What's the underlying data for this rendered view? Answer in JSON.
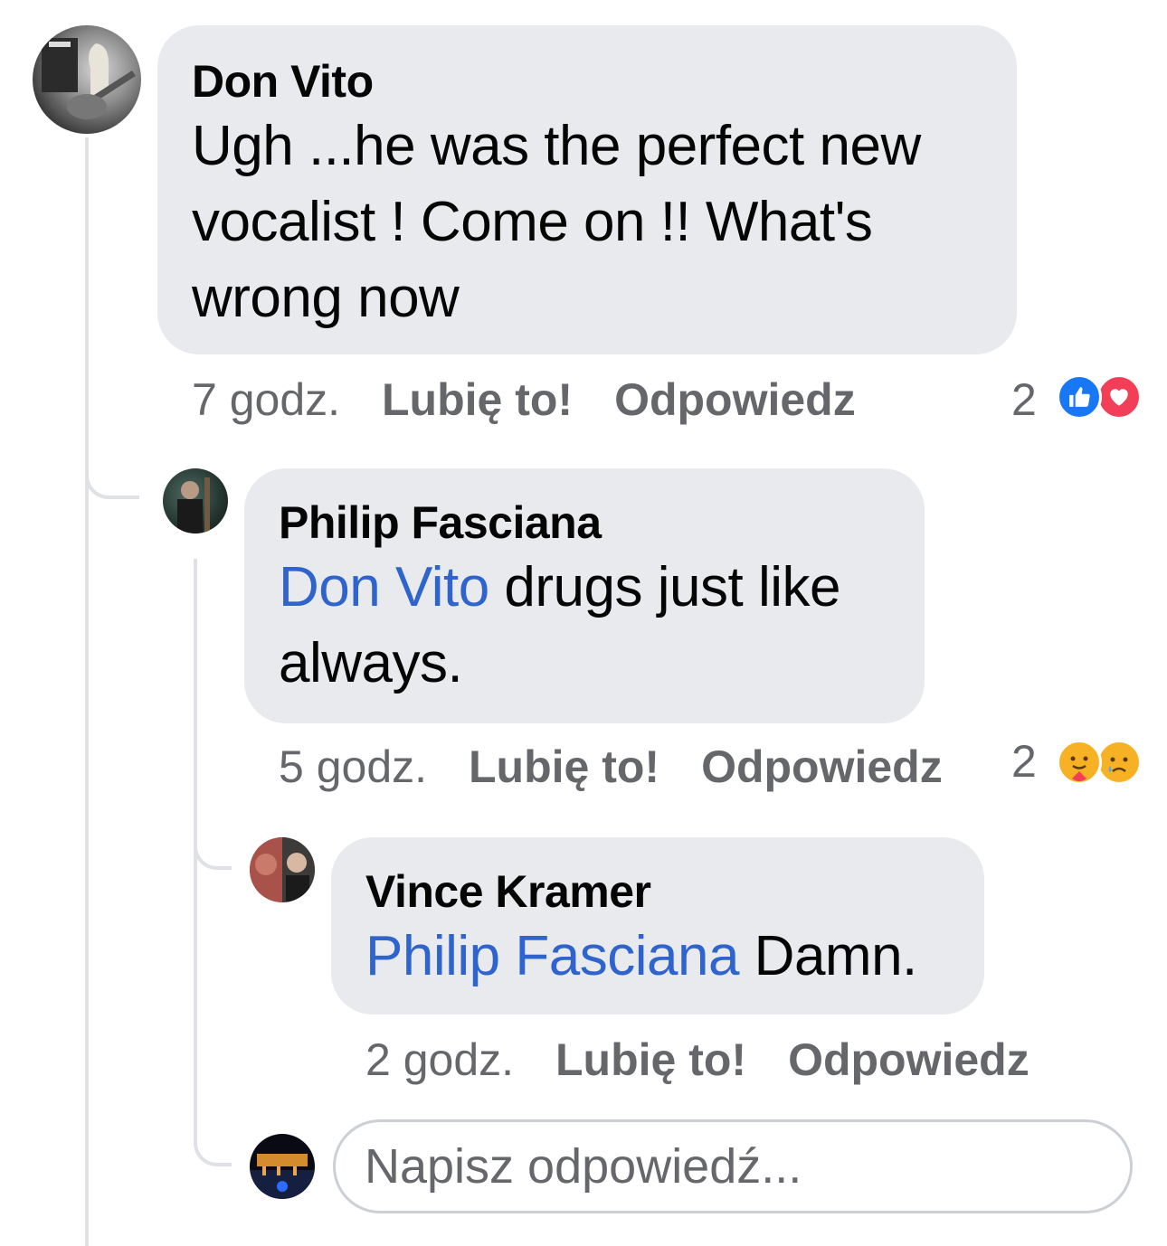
{
  "comments": [
    {
      "author": "Don Vito",
      "text": "Ugh ...he was the perfect new vocalist ! Come on !! What's wrong now",
      "time": "7 godz.",
      "like_label": "Lubię to!",
      "reply_label": "Odpowiedz",
      "reaction_count": "2",
      "reactions": [
        "like-icon",
        "love-icon"
      ]
    },
    {
      "author": "Philip Fasciana",
      "mention": "Don Vito",
      "text": "drugs just like always.",
      "time": "5 godz.",
      "like_label": "Lubię to!",
      "reply_label": "Odpowiedz",
      "reaction_count": "2",
      "reactions": [
        "care-icon",
        "sad-icon"
      ]
    },
    {
      "author": "Vince Kramer",
      "mention": "Philip Fasciana",
      "text": "Damn.",
      "time": "2 godz.",
      "like_label": "Lubię to!",
      "reply_label": "Odpowiedz"
    }
  ],
  "reply_input": {
    "placeholder": "Napisz odpowiedź..."
  },
  "colors": {
    "mention": "#2f64cc",
    "bubble": "#e9eaed",
    "meta": "#65676b",
    "like": "#1877f2",
    "love": "#f33e58"
  }
}
